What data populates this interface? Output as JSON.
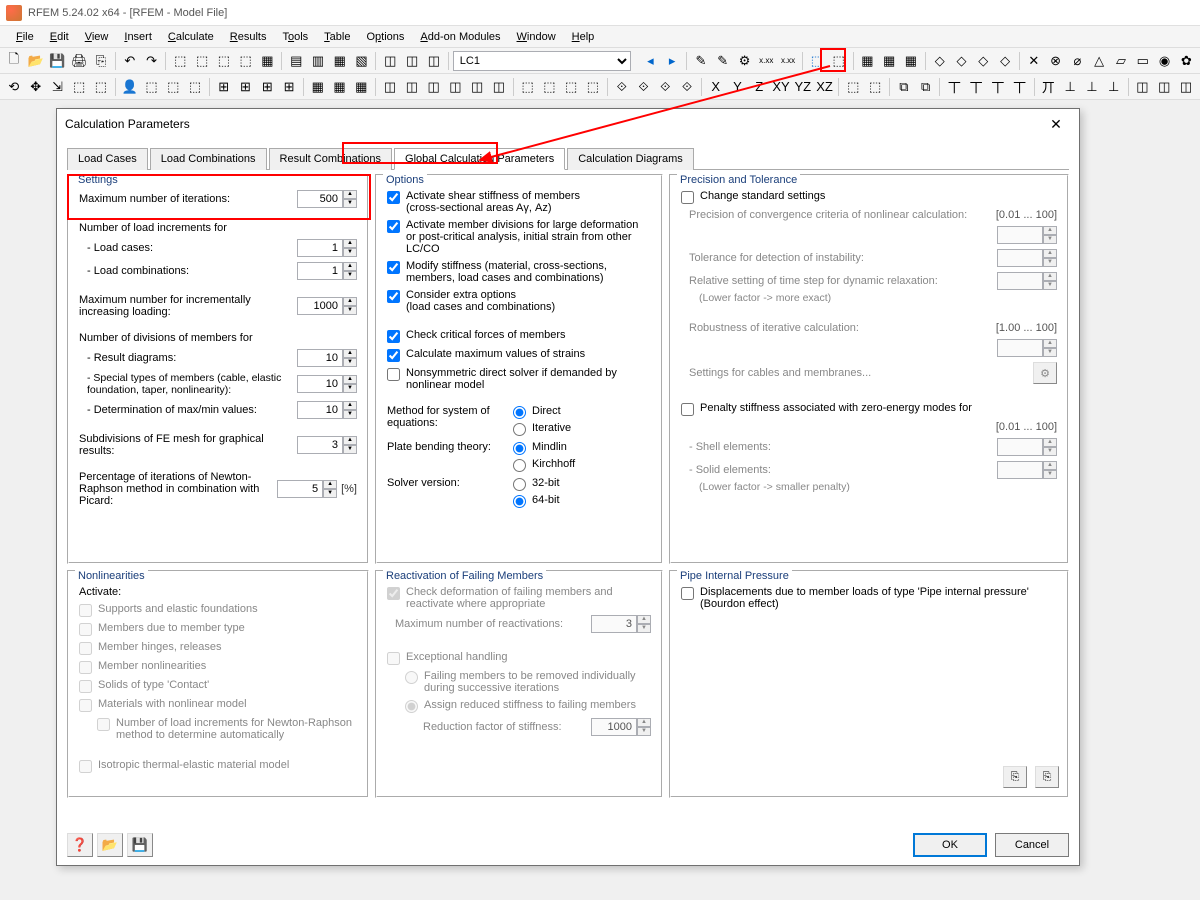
{
  "window": {
    "title": "RFEM 5.24.02 x64 - [RFEM - Model File]"
  },
  "menu": [
    "File",
    "Edit",
    "View",
    "Insert",
    "Calculate",
    "Results",
    "Tools",
    "Table",
    "Options",
    "Add-on Modules",
    "Window",
    "Help"
  ],
  "toolbar": {
    "combo": "LC1"
  },
  "dialog": {
    "title": "Calculation Parameters",
    "tabs": [
      "Load Cases",
      "Load Combinations",
      "Result Combinations",
      "Global Calculation Parameters",
      "Calculation Diagrams"
    ],
    "settings": {
      "title": "Settings",
      "maxIter": {
        "label": "Maximum number of iterations:",
        "value": "500"
      },
      "increments": {
        "heading": "Number of load increments for",
        "loadCases": {
          "label": "- Load cases:",
          "value": "1"
        },
        "loadCombos": {
          "label": "- Load combinations:",
          "value": "1"
        }
      },
      "maxIncremental": {
        "label": "Maximum number for incrementally increasing loading:",
        "value": "1000"
      },
      "divisions": {
        "heading": "Number of divisions of members for",
        "result": {
          "label": "- Result diagrams:",
          "value": "10"
        },
        "special": {
          "label": "- Special types of members (cable, elastic foundation, taper, nonlinearity):",
          "value": "10"
        },
        "maxmin": {
          "label": "- Determination of max/min values:",
          "value": "10"
        }
      },
      "feMesh": {
        "label": "Subdivisions of FE mesh for graphical results:",
        "value": "3"
      },
      "newton": {
        "label": "Percentage of iterations of Newton-Raphson method in combination with Picard:",
        "value": "5",
        "unit": "[%]"
      }
    },
    "options": {
      "title": "Options",
      "shear": "Activate shear stiffness of members",
      "shearNote": "(cross-sectional areas Aγ, Az)",
      "memberDiv": "Activate member divisions for large deformation or post-critical analysis, initial strain from other LC/CO",
      "modify": "Modify stiffness (material, cross-sections, members, load cases and combinations)",
      "extra": "Consider extra options",
      "extraNote": "(load cases and combinations)",
      "critical": "Check critical forces of members",
      "maxStrain": "Calculate maximum values of strains",
      "nonsym": "Nonsymmetric direct solver if demanded by nonlinear model",
      "method": {
        "label": "Method for system of equations:",
        "opts": [
          "Direct",
          "Iterative"
        ]
      },
      "plate": {
        "label": "Plate bending theory:",
        "opts": [
          "Mindlin",
          "Kirchhoff"
        ]
      },
      "solver": {
        "label": "Solver version:",
        "opts": [
          "32-bit",
          "64-bit"
        ]
      }
    },
    "precision": {
      "title": "Precision and Tolerance",
      "changeStd": "Change standard settings",
      "conv": {
        "label": "Precision of convergence criteria of nonlinear calculation:",
        "range": "[0.01 ... 100]"
      },
      "tolDetect": "Tolerance for detection of instability:",
      "timestep": "Relative setting of time step for dynamic relaxation:",
      "timestepHint": "(Lower factor -> more exact)",
      "robust": {
        "label": "Robustness of iterative calculation:",
        "range": "[1.00 ... 100]"
      },
      "cables": "Settings for cables and membranes...",
      "penalty": "Penalty stiffness associated with zero-energy modes for",
      "penaltyRange": "[0.01 ... 100]",
      "shell": "- Shell elements:",
      "solid": "- Solid elements:",
      "penaltyHint": "(Lower factor -> smaller penalty)"
    },
    "nonlin": {
      "title": "Nonlinearities",
      "activate": "Activate:",
      "items": [
        "Supports and elastic foundations",
        "Members due to member type",
        "Member hinges, releases",
        "Member nonlinearities",
        "Solids of type 'Contact'",
        "Materials with nonlinear model"
      ],
      "nrNote": "Number of load increments for Newton-Raphson method to determine automatically",
      "isotropic": "Isotropic thermal-elastic material model"
    },
    "reactivation": {
      "title": "Reactivation of Failing Members",
      "checkDef": "Check deformation of failing members and reactivate where appropriate",
      "maxReact": {
        "label": "Maximum number of reactivations:",
        "value": "3"
      },
      "exceptional": "Exceptional handling",
      "removed": "Failing members to be removed individually during successive iterations",
      "assign": "Assign reduced stiffness to failing members",
      "reduction": {
        "label": "Reduction factor of stiffness:",
        "value": "1000"
      }
    },
    "pipe": {
      "title": "Pipe Internal Pressure",
      "disp": "Displacements due to member loads of type 'Pipe internal pressure' (Bourdon effect)"
    },
    "buttons": {
      "ok": "OK",
      "cancel": "Cancel"
    }
  }
}
